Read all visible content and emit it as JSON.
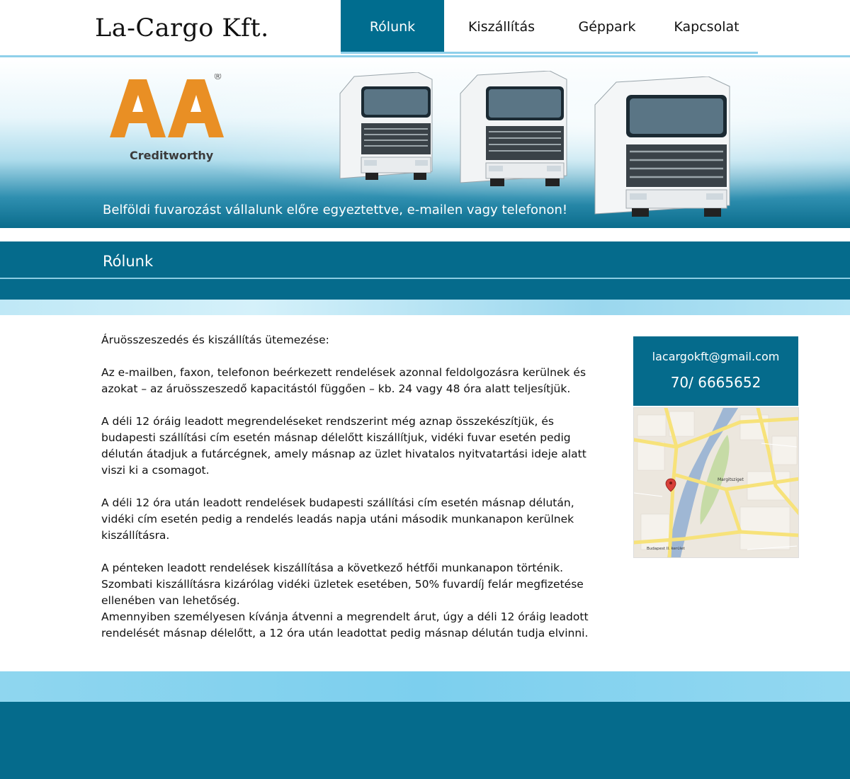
{
  "header": {
    "site_title": "La-Cargo Kft.",
    "nav": [
      {
        "label": "Rólunk",
        "active": true
      },
      {
        "label": "Kiszállítás",
        "active": false
      },
      {
        "label": "Géppark",
        "active": false
      },
      {
        "label": "Kapcsolat",
        "active": false
      }
    ]
  },
  "banner": {
    "logo_text": "AA",
    "logo_caption": "Creditworthy",
    "logo_mark": "®",
    "tagline": "Belföldi fuvarozást vállalunk előre egyeztettve, e-mailen vagy telefonon!"
  },
  "section": {
    "title": "Rólunk"
  },
  "content": {
    "paragraphs": [
      "Áruösszeszedés és kiszállítás ütemezése:",
      "Az e-mailben, faxon, telefonon beérkezett rendelések azonnal feldolgozásra kerülnek és azokat – az áruösszeszedő kapacitástól függően – kb. 24 vagy 48 óra alatt teljesítjük.",
      "A déli 12 óráig leadott megrendeléseket rendszerint még aznap összekészítjük, és budapesti szállítási cím esetén másnap délelőtt kiszállítjuk, vidéki fuvar esetén pedig délután átadjuk a futárcégnek, amely másnap az üzlet hivatalos nyitvatartási ideje alatt viszi ki a csomagot.",
      "A déli 12 óra után leadott rendelések budapesti szállítási cím esetén másnap délután, vidéki cím esetén pedig a rendelés leadás napja utáni második munkanapon kerülnek kiszállításra.",
      "A pénteken leadott rendelések kiszállítása a következő hétfői munkanapon történik.",
      "Szombati kiszállításra kizárólag vidéki üzletek esetében, 50% fuvardíj felár megfizetése ellenében van lehetőség.",
      "Amennyiben személyesen kívánja átvenni a megrendelt árut, úgy a déli 12 óráig leadott rendelését másnap délelőtt, a 12 óra után leadottat pedig másnap délután tudja elvinni."
    ]
  },
  "sidebar": {
    "email": "lacargokft@gmail.com",
    "phone": "70/ 6665652",
    "map_labels": [
      "Margitsziget",
      "Budapest II. kerület"
    ]
  },
  "colors": {
    "primary": "#056b8c",
    "accent_light": "#8fd0ea",
    "logo_orange": "#e98f24"
  }
}
